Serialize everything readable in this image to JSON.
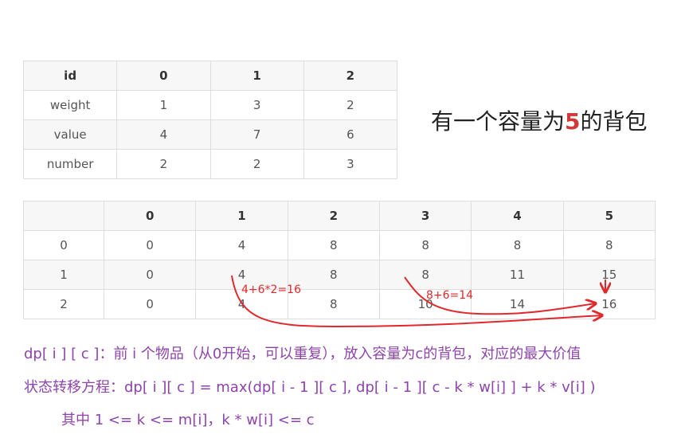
{
  "items_table": {
    "header": [
      "id",
      "0",
      "1",
      "2"
    ],
    "rows": [
      [
        "weight",
        "1",
        "3",
        "2"
      ],
      [
        "value",
        "4",
        "7",
        "6"
      ],
      [
        "number",
        "2",
        "2",
        "3"
      ]
    ]
  },
  "capacity_note": {
    "prefix": "有一个容量为",
    "value": "5",
    "suffix": "的背包"
  },
  "dp_table": {
    "header": [
      "",
      "0",
      "1",
      "2",
      "3",
      "4",
      "5"
    ],
    "rows": [
      [
        "0",
        "0",
        "4",
        "8",
        "8",
        "8",
        "8"
      ],
      [
        "1",
        "0",
        "4",
        "8",
        "8",
        "11",
        "15"
      ],
      [
        "2",
        "0",
        "4",
        "8",
        "10",
        "14",
        "16"
      ]
    ]
  },
  "annotations": {
    "calc1": "4+6*2=16",
    "calc2": "8+6=14",
    "arrow_color": "#e0292c"
  },
  "description": {
    "definition": "dp[ i ] [ c ]：前 i 个物品（从0开始，可以重复），放入容量为c的背包，对应的最大价值",
    "equation": "状态转移方程：dp[ i ][ c ] = max(dp[ i - 1 ][ c ], dp[ i - 1 ][ c - k * w[i] ] + k * v[i] )",
    "condition": "其中 1 <= k <= m[i]，k * w[i] <= c",
    "color": "#8e44ad"
  }
}
